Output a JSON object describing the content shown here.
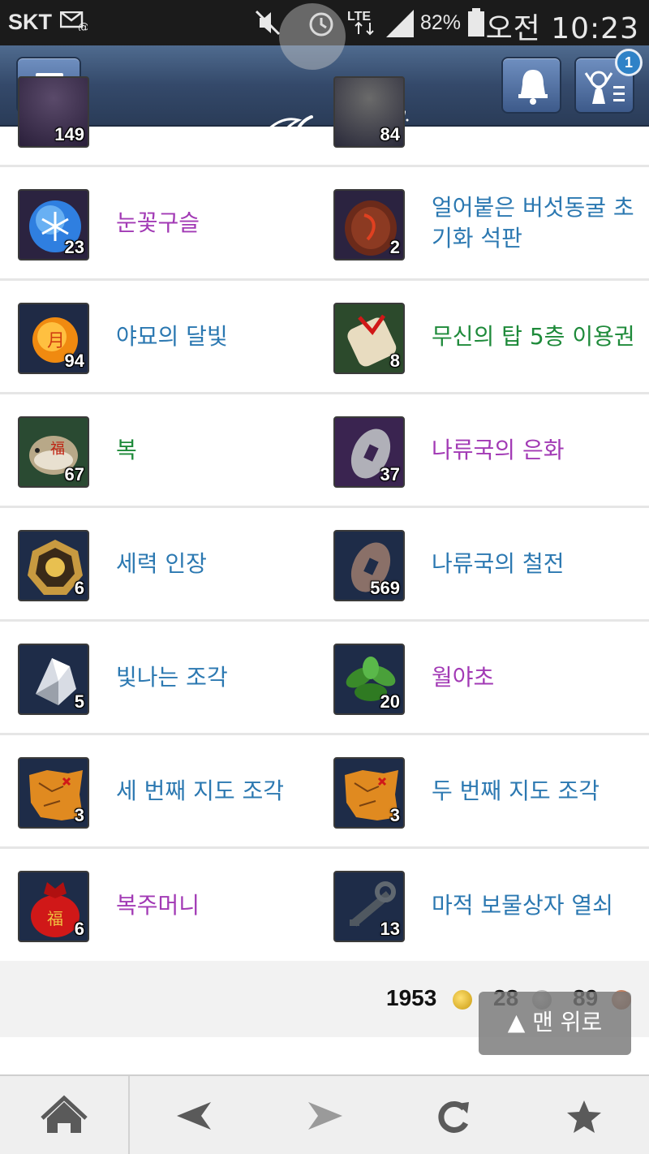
{
  "status_bar": {
    "carrier": "SKT",
    "network": "LTE",
    "battery": "82%",
    "time": "오전 10:23",
    "icons": [
      "message-icon",
      "mute-icon",
      "alarm-icon",
      "lte-icon",
      "signal-icon",
      "battery-icon"
    ]
  },
  "header": {
    "logo_alt": "Blade & Soul",
    "notification_count": "1",
    "icons": [
      "menu-icon",
      "bell-icon",
      "character-icon"
    ]
  },
  "items": [
    {
      "left": {
        "name": "",
        "count": "149",
        "color": "#a23ab5"
      },
      "right": {
        "name": "",
        "count": "84",
        "color": "#2b78b1"
      }
    },
    {
      "left": {
        "name": "눈꽃구슬",
        "count": "23",
        "color": "#a23ab5"
      },
      "right": {
        "name": "얼어붙은 버섯동굴 초기화 석판",
        "count": "2",
        "color": "#2b78b1"
      }
    },
    {
      "left": {
        "name": "야묘의 달빛",
        "count": "94",
        "color": "#2b78b1"
      },
      "right": {
        "name": "무신의 탑 5층 이용권",
        "count": "8",
        "color": "#1e8a3a"
      }
    },
    {
      "left": {
        "name": "복",
        "count": "67",
        "color": "#1e8a3a"
      },
      "right": {
        "name": "나류국의 은화",
        "count": "37",
        "color": "#a23ab5"
      }
    },
    {
      "left": {
        "name": "세력 인장",
        "count": "6",
        "color": "#2b78b1"
      },
      "right": {
        "name": "나류국의 철전",
        "count": "569",
        "color": "#2b78b1"
      }
    },
    {
      "left": {
        "name": "빛나는 조각",
        "count": "5",
        "color": "#2b78b1"
      },
      "right": {
        "name": "월야초",
        "count": "20",
        "color": "#a23ab5"
      }
    },
    {
      "left": {
        "name": "세 번째 지도 조각",
        "count": "3",
        "color": "#2b78b1"
      },
      "right": {
        "name": "두 번째 지도 조각",
        "count": "3",
        "color": "#2b78b1"
      }
    },
    {
      "left": {
        "name": "복주머니",
        "count": "6",
        "color": "#a23ab5"
      },
      "right": {
        "name": "마적 보물상자 열쇠",
        "count": "13",
        "color": "#2b78b1"
      }
    }
  ],
  "currency": {
    "gold": "1953",
    "silver": "28",
    "copper": "89"
  },
  "to_top_label": "▲ 맨 위로",
  "nav": {
    "icons": [
      "home-icon",
      "back-arrow-icon",
      "forward-arrow-icon",
      "refresh-icon",
      "star-icon"
    ]
  }
}
